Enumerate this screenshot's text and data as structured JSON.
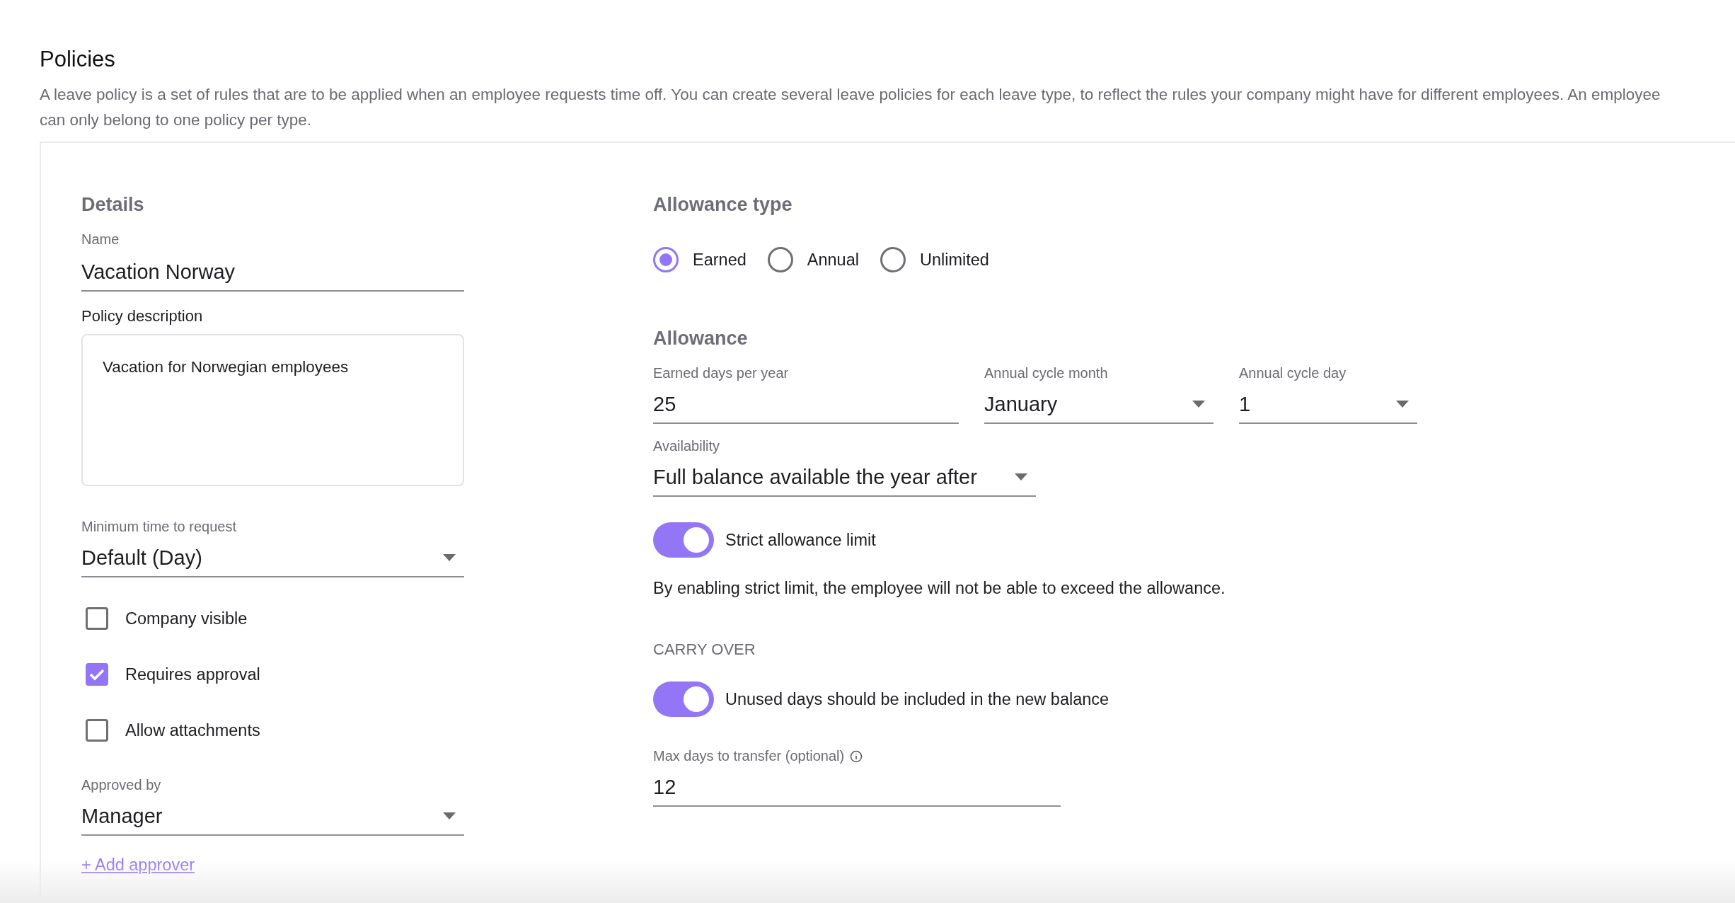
{
  "page": {
    "title": "Policies",
    "description": "A leave policy is a set of rules that are to be applied when an employee requests time off. You can create several leave policies for each leave type, to reflect the rules your company might have for different employees. An employee can only belong to one policy per type."
  },
  "details": {
    "heading": "Details",
    "name": {
      "label": "Name",
      "value": "Vacation Norway"
    },
    "description": {
      "label": "Policy description",
      "value": "Vacation for Norwegian employees"
    },
    "minimum_time": {
      "label": "Minimum time to request",
      "value": "Default (Day)"
    },
    "options": [
      {
        "label": "Company visible",
        "checked": false
      },
      {
        "label": "Requires approval",
        "checked": true
      },
      {
        "label": "Allow attachments",
        "checked": false
      }
    ],
    "approved_by": {
      "label": "Approved by",
      "value": "Manager"
    },
    "add_approver": "+ Add approver"
  },
  "allowance_type": {
    "heading": "Allowance type",
    "options": [
      {
        "label": "Earned",
        "selected": true
      },
      {
        "label": "Annual",
        "selected": false
      },
      {
        "label": "Unlimited",
        "selected": false
      }
    ]
  },
  "allowance": {
    "heading": "Allowance",
    "fields": [
      {
        "kind": "input",
        "label": "Earned days per year",
        "value": "25"
      },
      {
        "kind": "select",
        "label": "Annual cycle month",
        "value": "January"
      },
      {
        "kind": "select",
        "label": "Annual cycle day",
        "value": "1"
      }
    ],
    "availability": {
      "label": "Availability",
      "value": "Full balance available the year after"
    },
    "strict_limit": {
      "label": "Strict allowance limit",
      "on": true
    },
    "strict_help": "By enabling strict limit, the employee will not be able to exceed the allowance."
  },
  "carry_over": {
    "heading": "CARRY OVER",
    "toggle": {
      "label": "Unused days should be included in the new balance",
      "on": true
    },
    "max_days": {
      "label": "Max days to transfer (optional)",
      "value": "12"
    }
  }
}
